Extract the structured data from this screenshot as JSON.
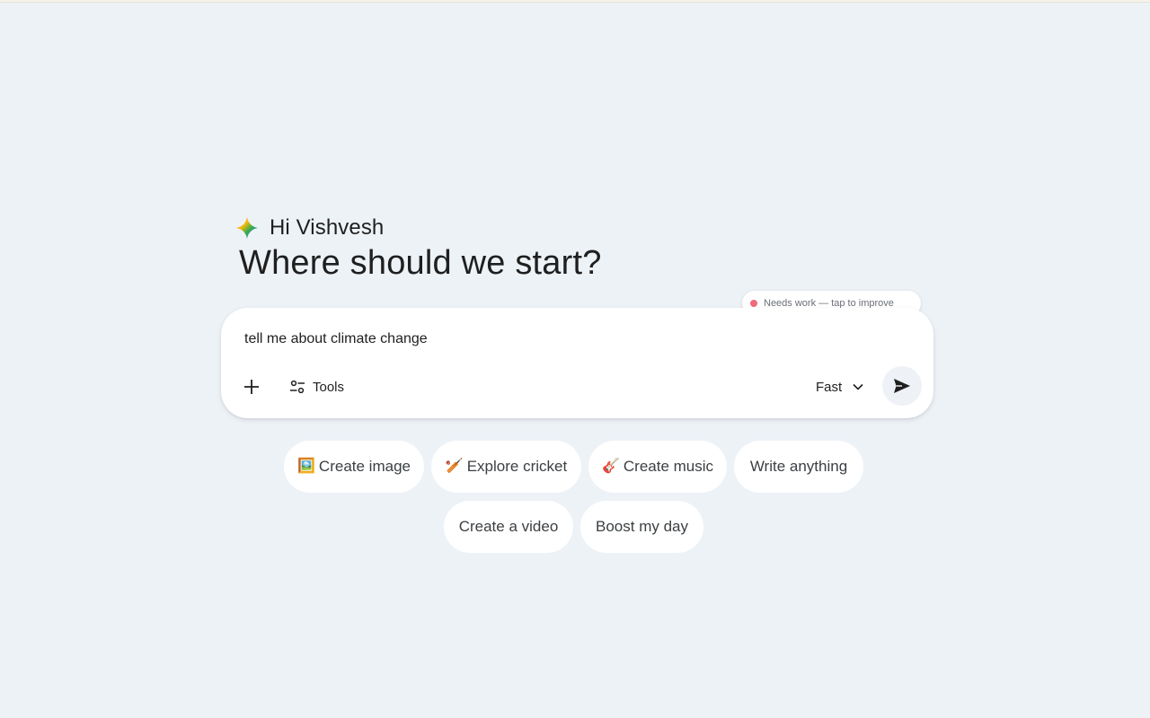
{
  "greeting": {
    "text": "Hi Vishvesh",
    "headline": "Where should we start?"
  },
  "prompt": {
    "value": "tell me about climate change",
    "tools_label": "Tools",
    "model_label": "Fast"
  },
  "feedback": {
    "text": "Needs work — tap to improve",
    "dot_color": "#f06a7a"
  },
  "chips": [
    {
      "emoji": "🖼️",
      "label": "Create image"
    },
    {
      "emoji": "🏏",
      "label": "Explore cricket"
    },
    {
      "emoji": "🎸",
      "label": "Create music"
    },
    {
      "emoji": "",
      "label": "Write anything"
    },
    {
      "emoji": "",
      "label": "Create a video"
    },
    {
      "emoji": "",
      "label": "Boost my day"
    }
  ],
  "icons": {
    "brand": "gemini-spark-icon",
    "add": "plus-icon",
    "tools": "tools-sliders-icon",
    "dropdown": "chevron-down-icon",
    "send": "send-icon"
  },
  "colors": {
    "background": "#edf2f7",
    "surface": "#ffffff",
    "send_button_bg": "#eef1f5"
  }
}
